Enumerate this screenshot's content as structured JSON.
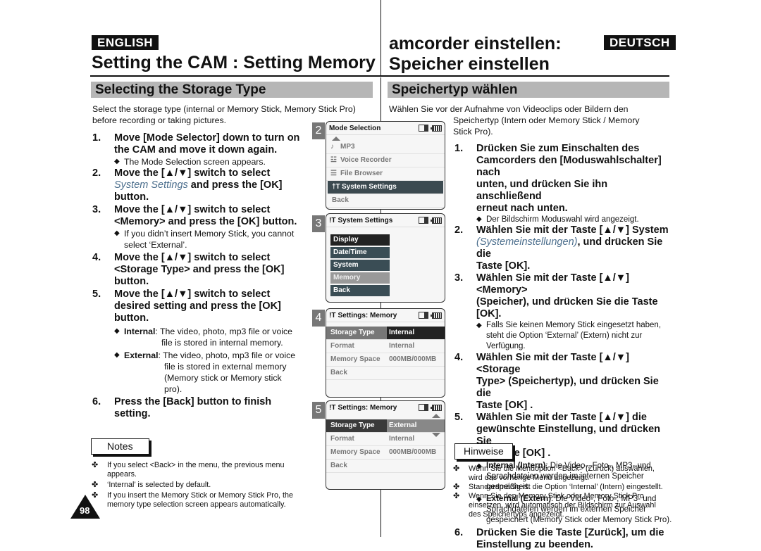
{
  "header": {
    "english_tag": "ENGLISH",
    "deutsch_tag": "DEUTSCH",
    "title_en": "Setting the CAM : Setting Memory",
    "title_de_line1": "amcorder einstellen:",
    "title_de_line2": "Speicher einstellen"
  },
  "en": {
    "section": "Selecting the Storage Type",
    "intro_line1": "Select the storage type (internal or Memory Stick, Memory Stick Pro)",
    "intro_line2": "before recording or taking pictures.",
    "steps": [
      {
        "num": "1.",
        "line1": "Move [Mode Selector] down to turn on",
        "line2": " the CAM and move it down again.",
        "sub": "The Mode Selection screen appears."
      },
      {
        "num": "2.",
        "line1": "Move the [▲/▼] switch to select",
        "italic": "System Settings",
        "line2_rest": " and press the [OK]",
        "line3": "button."
      },
      {
        "num": "3.",
        "line1": "Move the [▲/▼] switch to select",
        "line2": "<Memory> and press the [OK] button.",
        "sub1": "If you didn’t insert Memory Stick, you cannot",
        "sub2": "select ‘External’."
      },
      {
        "num": "4.",
        "line1": "Move the [▲/▼] switch to select",
        "line2": "<Storage Type> and press the [OK]",
        "line3": "button."
      },
      {
        "num": "5.",
        "line1": "Move the [▲/▼] switch to select",
        "line2": "desired setting and press the [OK]",
        "line3": "button.",
        "internal_label": "Internal",
        "internal_text1": ": The video, photo, mp3 file or voice",
        "internal_text2": "file is stored in internal memory.",
        "external_label": "External",
        "external_text1": ": The video, photo, mp3 file or voice",
        "external_text2": "file is stored in external memory",
        "external_text3": "(Memory stick or Memory stick",
        "external_text4": "pro)."
      },
      {
        "num": "6.",
        "line1": "Press the [Back] button to finish",
        "line2": "setting."
      }
    ],
    "notes_label": "Notes",
    "notes": [
      {
        "line1": "If you select <Back> in the menu, the previous menu",
        "line2": "appears."
      },
      {
        "line1": "‘Internal’ is selected by default."
      },
      {
        "line1": "If you insert the Memory Stick or Memory Stick Pro, the",
        "line2": "memory type selection screen appears automatically."
      }
    ],
    "page_number": "98"
  },
  "screens": {
    "s2": {
      "num": "2",
      "title": "Mode Selection",
      "items": [
        {
          "icon": "music-note-icon",
          "glyph": "♪",
          "label": "MP3"
        },
        {
          "icon": "microphone-icon",
          "glyph": "☳",
          "label": "Voice Recorder"
        },
        {
          "icon": "file-icon",
          "glyph": "☰",
          "label": "File Browser"
        },
        {
          "icon": "tools-icon",
          "glyph": "†T",
          "label": "System Settings"
        },
        {
          "icon": "",
          "glyph": "",
          "label": "Back"
        }
      ]
    },
    "s3": {
      "num": "3",
      "title": "System Settings",
      "items": [
        "Display",
        "Date/Time",
        "System",
        "Memory",
        "Back"
      ]
    },
    "s4": {
      "num": "4",
      "title": "Settings: Memory",
      "rows": [
        {
          "k": "Storage Type",
          "v": "Internal"
        },
        {
          "k": "Format",
          "v": "Internal"
        },
        {
          "k": "Memory Space",
          "v": "000MB/000MB"
        },
        {
          "k": "Back",
          "v": ""
        }
      ]
    },
    "s5": {
      "num": "5",
      "title": "Settings: Memory",
      "rows": [
        {
          "k": "Storage Type",
          "v": "External"
        },
        {
          "k": "Format",
          "v": "Internal"
        },
        {
          "k": "Memory Space",
          "v": "000MB/000MB"
        },
        {
          "k": "Back",
          "v": ""
        }
      ]
    }
  },
  "de": {
    "section": "Speichertyp wählen",
    "intro_line1": "Wählen Sie vor der Aufnahme von Videoclips oder Bildern den",
    "intro_line2": "Speichertyp (Intern oder Memory Stick / Memory",
    "intro_line3": "Stick Pro).",
    "steps": [
      {
        "num": "1.",
        "line1": "Drücken Sie zum Einschalten des",
        "line2": "Camcorders den [Moduswahlschalter] nach",
        "line3": "unten, und drücken Sie ihn anschließend",
        "line4": "erneut nach unten.",
        "sub": "Der Bildschirm Moduswahl wird angezeigt."
      },
      {
        "num": "2.",
        "line1": "Wählen Sie mit der Taste [▲/▼] System",
        "italic": "(Systemeinstellungen)",
        "line2_rest": ", und drücken Sie die",
        "line3": "Taste [OK]."
      },
      {
        "num": "3.",
        "line1": "Wählen Sie mit der Taste [▲/▼] <Memory>",
        "line2": "(Speicher), und drücken Sie die  Taste [OK].",
        "sub1": "Falls Sie keinen Memory Stick eingesetzt haben,",
        "sub2": "steht die Option ‘External’ (Extern) nicht zur",
        "sub3": "Verfügung."
      },
      {
        "num": "4.",
        "line1": "Wählen Sie mit der Taste [▲/▼] <Storage",
        "line2": "Type> (Speichertyp), und drücken Sie die",
        "line3": "Taste [OK] ."
      },
      {
        "num": "5.",
        "line1": "Wählen Sie mit der Taste [▲/▼] die",
        "line2": "gewünschte Einstellung, und drücken Sie",
        "line3": "die Taste [OK] .",
        "internal_label": "Internal (Intern)",
        "internal_text1": ": Die Video-, Foto-, MP3- und",
        "internal_text2": "Sprachdateien werden im internen Speicher",
        "internal_text3": "gespeichert.",
        "external_label": "External (Extern)",
        "external_text1": ": Die Video-, Foto-, MP3- und",
        "external_text2": "Sprachdateien werden im externen Speicher",
        "external_text3": "gespeichert (Memory Stick oder Memory Stick Pro)."
      },
      {
        "num": "6.",
        "line1": "Drücken Sie die Taste [Zurück], um die",
        "line2": "Einstellung zu beenden."
      }
    ],
    "notes_label": "Hinweise",
    "notes": [
      {
        "line1": "Wenn Sie die Menüoption <Back> (Zurück) auswählen,",
        "line2": "wird das vorherige Menü angezeigt."
      },
      {
        "line1": "Standardmäßig ist die Option ‘Internal’ (Intern) eingestellt."
      },
      {
        "line1": "Wenn Sie den Memory Stick oder Memory Stick Pro",
        "line2": "einsetzen, wird automatisch der Bildschirm zur Auswahl",
        "line3": "des Speichertyps angezeigt."
      }
    ]
  },
  "glyphs": {
    "diamond": "◆",
    "clover": "✤"
  }
}
